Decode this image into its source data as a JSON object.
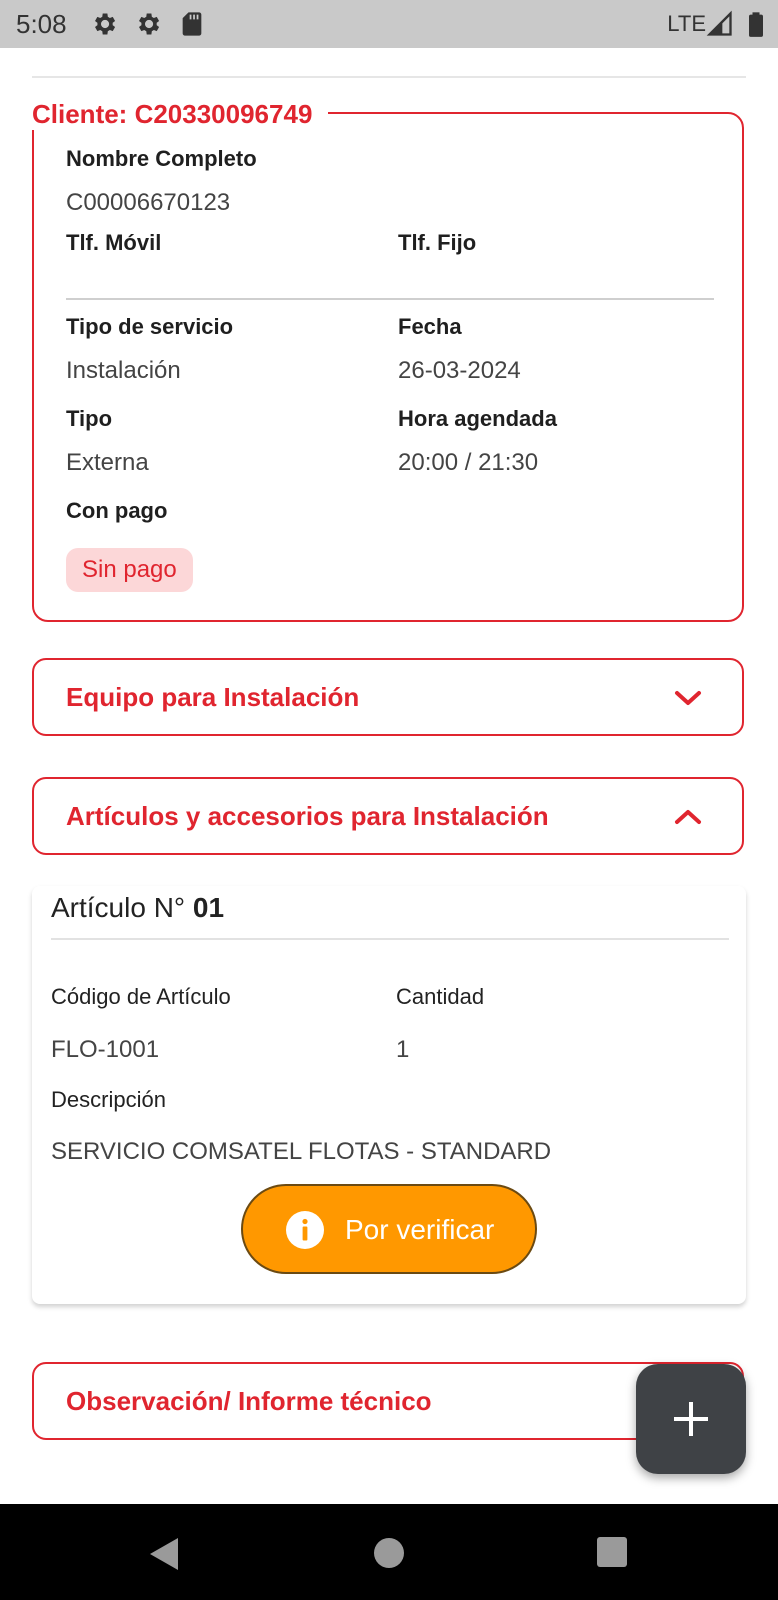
{
  "status_bar": {
    "time": "5:08",
    "network": "LTE",
    "icons": [
      "gear-icon",
      "gear-icon",
      "sd-card-icon",
      "signal-icon",
      "battery-icon"
    ]
  },
  "client": {
    "legend": "Cliente: C20330096749",
    "nombre_label": "Nombre Completo",
    "nombre_value": "C00006670123",
    "movil_label": "Tlf. Móvil",
    "fijo_label": "Tlf. Fijo",
    "tipo_servicio_label": "Tipo de servicio",
    "tipo_servicio_value": "Instalación",
    "fecha_label": "Fecha",
    "fecha_value": "26-03-2024",
    "tipo_label": "Tipo",
    "tipo_value": "Externa",
    "hora_label": "Hora agendada",
    "hora_value": "20:00 / 21:30",
    "con_pago_label": "Con pago",
    "pago_badge": "Sin pago"
  },
  "sections": {
    "equipo": "Equipo para Instalación",
    "articulos": "Artículos y accesorios para Instalación",
    "observacion": "Observación/ Informe técnico"
  },
  "article": {
    "title_prefix": "Artículo N°",
    "number": "01",
    "codigo_label": "Código de Artículo",
    "codigo_value": "FLO-1001",
    "cantidad_label": "Cantidad",
    "cantidad_value": "1",
    "descripcion_label": "Descripción",
    "descripcion_value": "SERVICIO COMSATEL FLOTAS - STANDARD",
    "status_button": "Por verificar"
  },
  "colors": {
    "accent": "#e0252f",
    "badge_bg": "#fcd7d8",
    "verify": "#ff9800",
    "fab": "#3f4246"
  }
}
